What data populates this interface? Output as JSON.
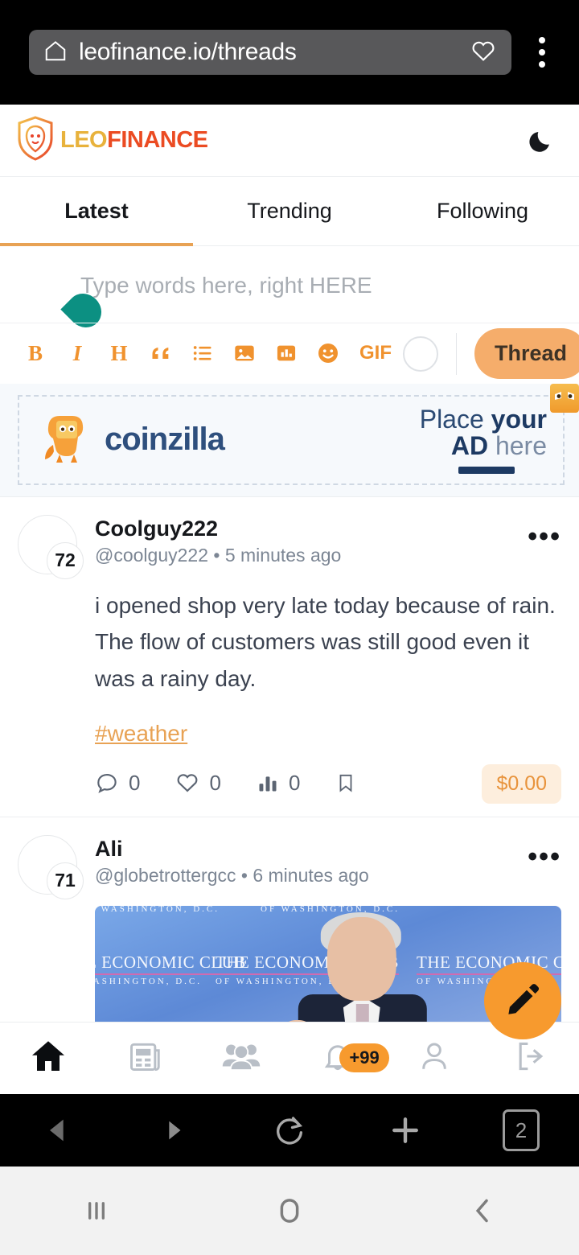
{
  "browser": {
    "url": "leofinance.io/threads",
    "home_icon": "home-icon",
    "bookmark_icon": "heart-icon",
    "menu_icon": "kebab-menu-icon",
    "bottom": {
      "back": "back-arrow-icon",
      "forward": "forward-arrow-icon",
      "reload": "reload-icon",
      "new_tab": "plus-icon",
      "tab_count": "2"
    }
  },
  "system_nav": {
    "recents": "recents-icon",
    "home": "home-circle-icon",
    "back": "back-chevron-icon"
  },
  "header": {
    "brand_leo": "LEO",
    "brand_finance": "FINANCE",
    "theme_toggle": "moon-icon"
  },
  "tabs": [
    {
      "label": "Latest",
      "active": true
    },
    {
      "label": "Trending",
      "active": false
    },
    {
      "label": "Following",
      "active": false
    }
  ],
  "composer": {
    "placeholder": "Type words here, right HERE",
    "avatar_color": "#0c9082",
    "toolbar": [
      {
        "name": "bold",
        "label": "B"
      },
      {
        "name": "italic",
        "label": "I"
      },
      {
        "name": "heading",
        "label": "H"
      },
      {
        "name": "quote",
        "label": "“"
      },
      {
        "name": "list",
        "label": "list-icon"
      },
      {
        "name": "image",
        "label": "image-icon"
      },
      {
        "name": "poll",
        "label": "poll-icon"
      },
      {
        "name": "emoji",
        "label": "emoji-icon"
      },
      {
        "name": "gif",
        "label": "GIF"
      }
    ],
    "submit_label": "Thread"
  },
  "ad": {
    "brand": "coinzilla",
    "line1_plain": "Place ",
    "line1_bold": "your",
    "line2_bold": "AD",
    "line2_plain": " here",
    "badge_icon": "coinzilla-mascot-icon"
  },
  "posts": [
    {
      "display_name": "Coolguy222",
      "handle": "@coolguy222",
      "separator": "•",
      "timestamp": "5 minutes ago",
      "reputation": "72",
      "body": "i opened shop very late today because of rain. The flow of customers was still good even it was a rainy day.",
      "tag": "#weather",
      "actions": {
        "comments": "0",
        "likes": "0",
        "views": "0",
        "bookmark_icon": "bookmark-icon"
      },
      "payout": "$0.00"
    },
    {
      "display_name": "Ali",
      "handle": "@globetrottergcc",
      "separator": "•",
      "timestamp": "6 minutes ago",
      "reputation": "71",
      "media": {
        "type": "video-thumbnail",
        "watermark_title": "THE ECONOMIC CLUB",
        "watermark_subtitle": "OF WASHINGTON, D.C."
      }
    }
  ],
  "fab": {
    "icon": "pencil-icon"
  },
  "bottom_nav": [
    {
      "name": "home",
      "icon": "home-filled-icon",
      "active": true
    },
    {
      "name": "feed",
      "icon": "newspaper-icon",
      "active": false
    },
    {
      "name": "communities",
      "icon": "people-icon",
      "active": false
    },
    {
      "name": "notifications",
      "icon": "bell-icon",
      "active": false,
      "badge": "+99"
    },
    {
      "name": "profile",
      "icon": "person-icon",
      "active": false
    },
    {
      "name": "logout",
      "icon": "logout-icon",
      "active": false
    }
  ],
  "colors": {
    "accent": "#f0922e",
    "brand_leo": "#e8b23c",
    "brand_finance": "#eb4b22",
    "tab_underline": "#e8a254",
    "payout_bg": "#fdeedd"
  }
}
